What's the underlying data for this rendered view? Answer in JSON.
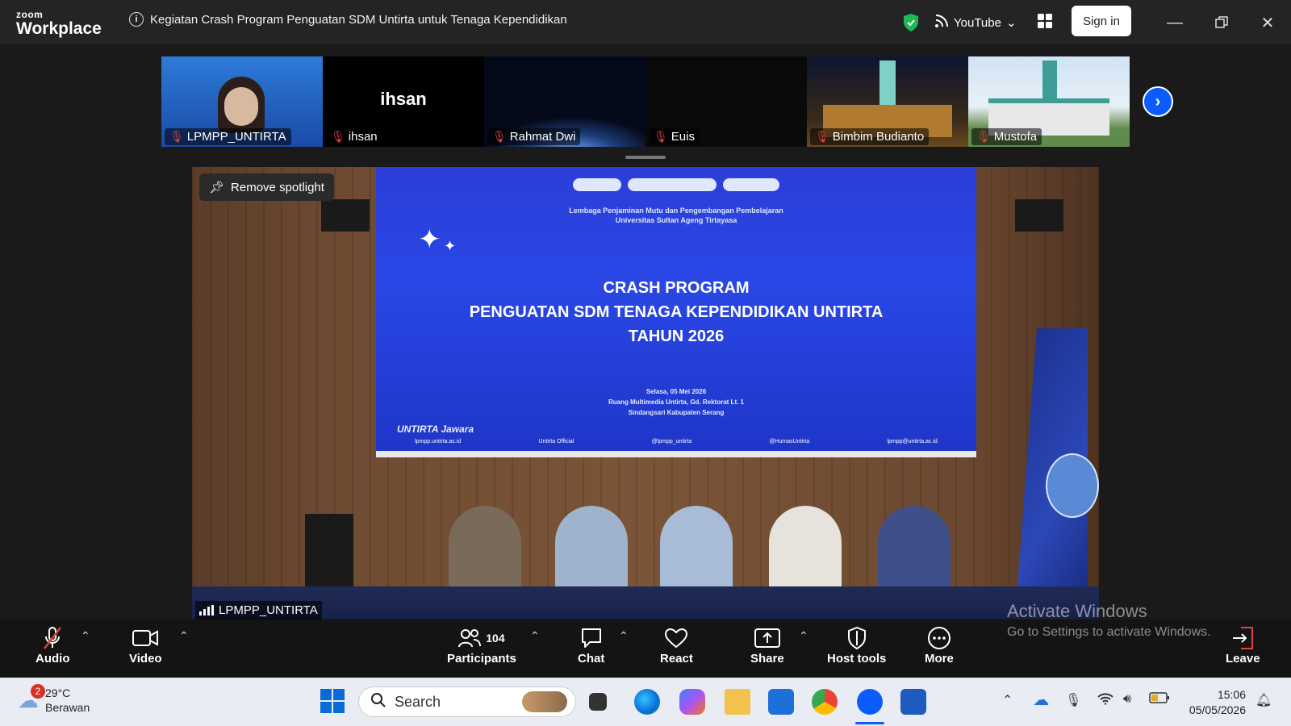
{
  "titlebar": {
    "logo_line1": "zoom",
    "logo_line2": "Workplace",
    "meeting_title": "Kegiatan  Crash Program Penguatan SDM Untirta untuk Tenaga Kependidikan",
    "stream_label": "YouTube",
    "signin_label": "Sign in"
  },
  "thumbnails": [
    {
      "name": "LPMPP_UNTIRTA",
      "muted": true,
      "kind": "video"
    },
    {
      "name": "ihsan",
      "muted": true,
      "kind": "name",
      "display": "ihsan"
    },
    {
      "name": "Rahmat Dwi",
      "muted": true,
      "kind": "earth"
    },
    {
      "name": "Euis",
      "muted": true,
      "kind": "black"
    },
    {
      "name": "Bimbim Budianto",
      "muted": true,
      "kind": "building-night"
    },
    {
      "name": "Mustofa",
      "muted": true,
      "kind": "building-day"
    }
  ],
  "spotlight": {
    "remove_label": "Remove spotlight",
    "participant_name": "LPMPP_UNTIRTA"
  },
  "slide": {
    "org_line1": "Lembaga Penjaminan Mutu dan Pengembangan Pembelajaran",
    "org_line2": "Universitas Sultan Ageng Tirtayasa",
    "title_line1": "CRASH PROGRAM",
    "title_line2": "PENGUATAN SDM TENAGA KEPENDIDIKAN UNTIRTA",
    "title_line3": "TAHUN 2026",
    "date": "Selasa, 05 Mei 2026",
    "venue": "Ruang Multimedia Untirta, Gd. Rektorat Lt. 1",
    "location": "Sindangsari Kabupaten Serang",
    "brand": "UNTIRTA Jawara",
    "footer_web": "lpmpp.untirta.ac.id",
    "footer_fb": "Untirta Official",
    "footer_ig": "@lpmpp_untirta",
    "footer_humas": "@HumasUntirta",
    "footer_mail": "lpmpp@untirta.ac.id"
  },
  "toolbar": {
    "audio": "Audio",
    "video": "Video",
    "participants": "Participants",
    "participants_count": "104",
    "chat": "Chat",
    "react": "React",
    "share": "Share",
    "host_tools": "Host tools",
    "more": "More",
    "leave": "Leave"
  },
  "watermark": {
    "line1": "Activate Windows",
    "line2": "Go to Settings to activate Windows."
  },
  "taskbar": {
    "weather_badge": "2",
    "temperature": "29°C",
    "condition": "Berawan",
    "search_label": "Search",
    "time": "15:06",
    "date": "05/05/2026"
  },
  "colors": {
    "accent": "#0b5cff",
    "muted_mic": "#e04040",
    "shield": "#1db954"
  }
}
